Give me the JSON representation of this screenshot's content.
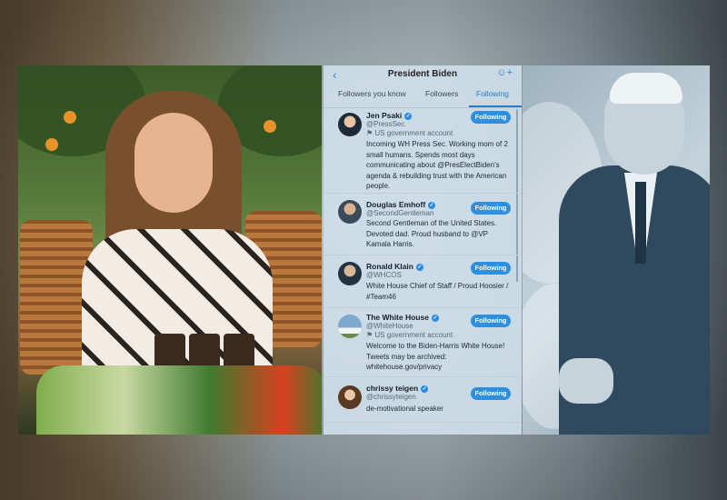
{
  "header": {
    "title": "President Biden",
    "back_icon": "chevron-left-icon",
    "add_icon": "add-user-icon"
  },
  "tabs": [
    {
      "label": "Followers you know",
      "active": false
    },
    {
      "label": "Followers",
      "active": false
    },
    {
      "label": "Following",
      "active": true
    }
  ],
  "accounts": [
    {
      "name": "Jen Psaki",
      "handle": "@PressSec",
      "badge": "US government account",
      "bio": "Incoming WH Press Sec. Working mom of 2 small humans. Spends most days communicating about @PresElectBiden's agenda & rebuilding trust with the American people.",
      "button": "Following"
    },
    {
      "name": "Douglas Emhoff",
      "handle": "@SecondGentleman",
      "badge": "",
      "bio": "Second Gentleman of the United States. Devoted dad. Proud husband to @VP Kamala Harris.",
      "button": "Following"
    },
    {
      "name": "Ronald Klain",
      "handle": "@WHCOS",
      "badge": "",
      "bio": "White House Chief of Staff / Proud Hoosier / #Team46",
      "button": "Following"
    },
    {
      "name": "The White House",
      "handle": "@WhiteHouse",
      "badge": "US government account",
      "bio": "Welcome to the Biden-Harris White House! Tweets may be archived: whitehouse.gov/privacy",
      "button": "Following"
    },
    {
      "name": "chrissy teigen",
      "handle": "@chrissyteigen",
      "badge": "",
      "bio": "de-motivational speaker",
      "button": "Following"
    }
  ],
  "colors": {
    "accent": "#2d8fe0",
    "panel_bg": "#cedee9",
    "verified": "#2a8be0"
  }
}
